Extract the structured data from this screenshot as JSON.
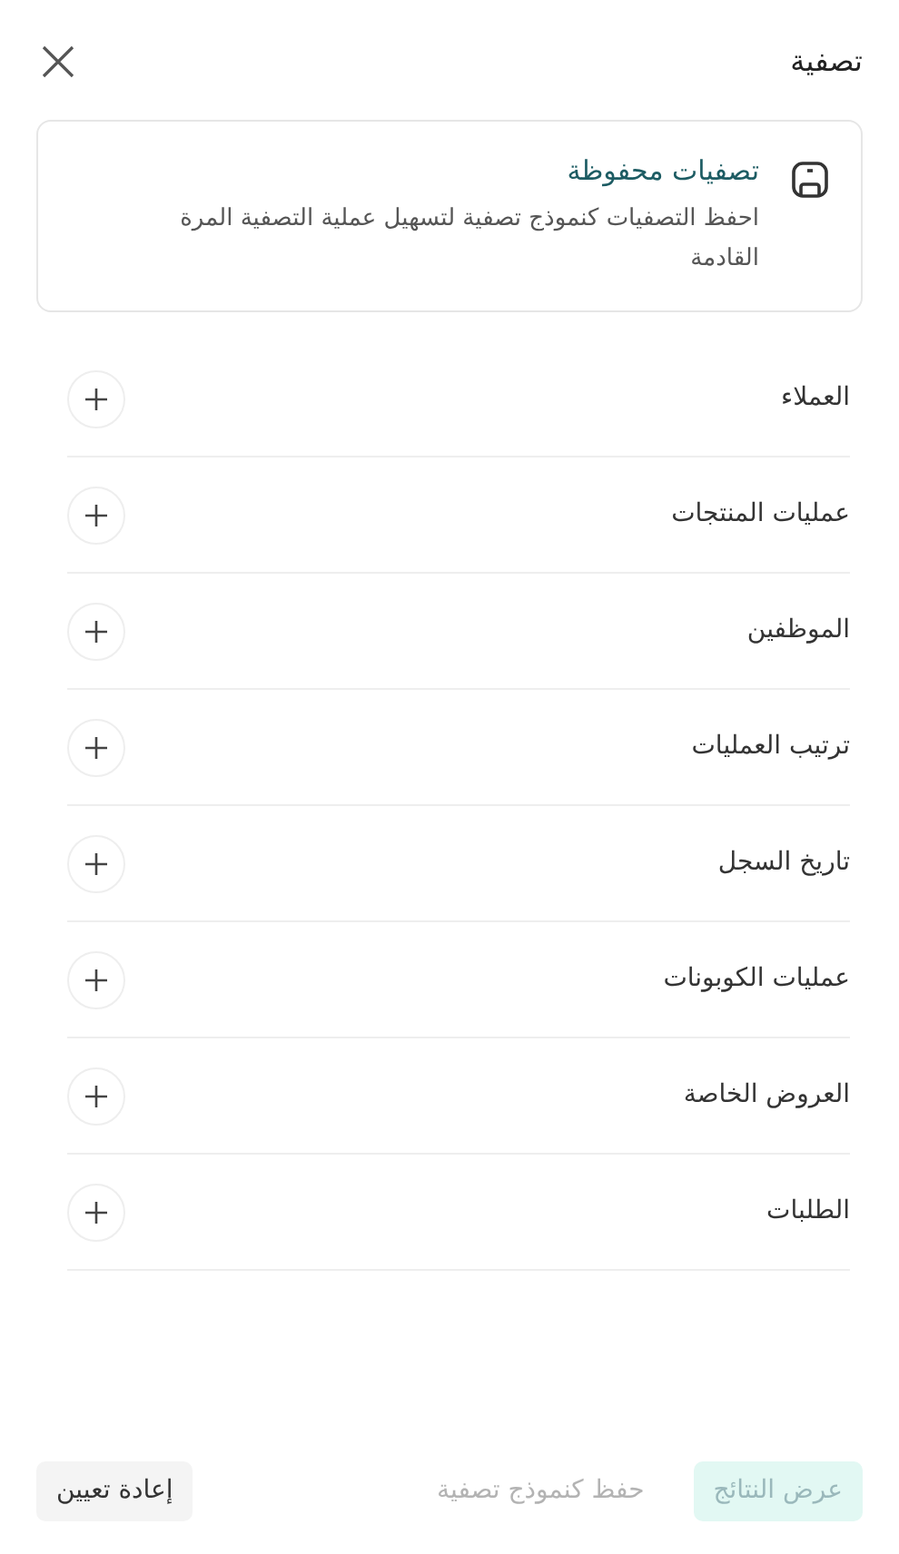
{
  "header": {
    "title": "تصفية"
  },
  "saved_filters": {
    "title": "تصفيات محفوظة",
    "description": "احفظ التصفيات كنموذج تصفية لتسهيل عملية التصفية المرة القادمة"
  },
  "sections": [
    {
      "label": "العملاء",
      "expanded": false
    },
    {
      "label": "عمليات المنتجات",
      "expanded": false
    },
    {
      "label": "الموظفين",
      "expanded": false
    },
    {
      "label": "ترتيب العمليات",
      "expanded": false
    },
    {
      "label": "تاريخ السجل",
      "expanded": false
    },
    {
      "label": "عمليات الكوبونات",
      "expanded": false
    },
    {
      "label": "العروض الخاصة",
      "expanded": false
    },
    {
      "label": "الطلبات",
      "expanded": false
    }
  ],
  "buttons": [
    {
      "label": "عرض النتائج",
      "kind": "primary",
      "disabled": true
    },
    {
      "label": "حفظ كنموذج تصفية",
      "kind": "link",
      "disabled": true
    },
    {
      "label": "إعادة تعيين",
      "kind": "secondary",
      "disabled": false
    }
  ]
}
